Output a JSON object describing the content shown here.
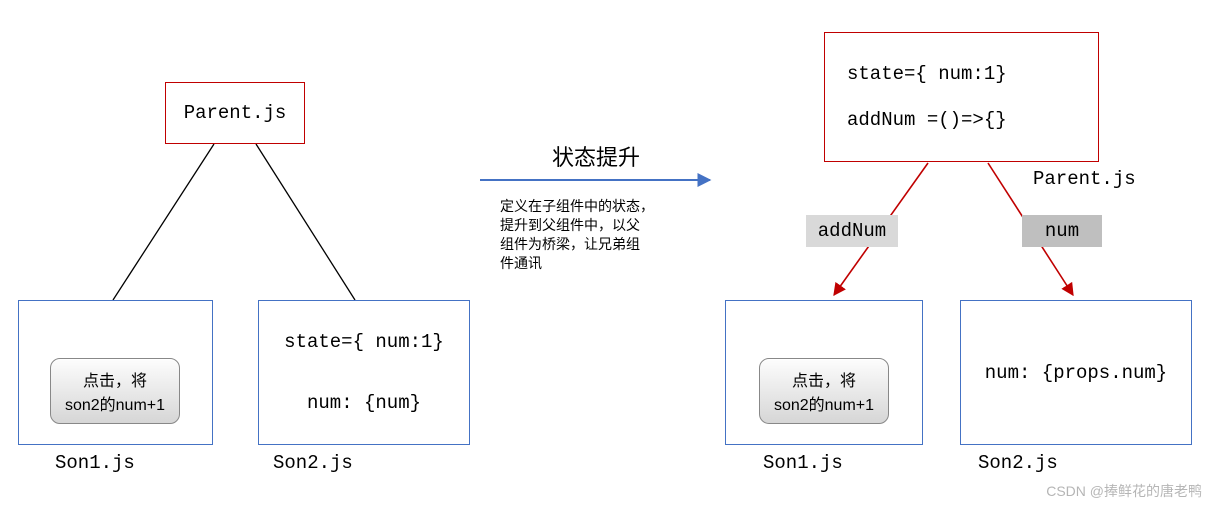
{
  "left": {
    "parent": {
      "label": "Parent.js"
    },
    "son1": {
      "button_line1": "点击，将",
      "button_line2": "son2的num+1",
      "label": "Son1.js"
    },
    "son2": {
      "line1": "state={ num:1}",
      "line2": "num: {num}",
      "label": "Son2.js"
    }
  },
  "arrow": {
    "title": "状态提升",
    "desc_l1": "定义在子组件中的状态，",
    "desc_l2": "提升到父组件中，以父",
    "desc_l3": "组件为桥梁，让兄弟组",
    "desc_l4": "件通讯"
  },
  "right": {
    "parent": {
      "line1": "state={ num:1}",
      "line2": "addNum =()=>{}",
      "label": "Parent.js"
    },
    "tag_left": "addNum",
    "tag_right": "num",
    "son1": {
      "button_line1": "点击，将",
      "button_line2": "son2的num+1",
      "label": "Son1.js"
    },
    "son2": {
      "line1": "num: {props.num}",
      "label": "Son2.js"
    }
  },
  "watermark": "CSDN @捧鲜花的唐老鸭"
}
